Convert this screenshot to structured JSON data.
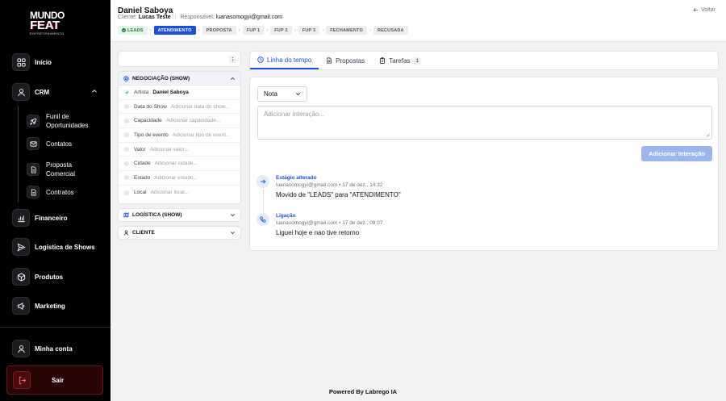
{
  "brand": {
    "line1": "MUNDO",
    "line2": "FEAT",
    "line3": "ENTRETENIMENTO"
  },
  "sidebar": {
    "items": [
      {
        "label": "Início",
        "icon": "grid-icon"
      },
      {
        "label": "CRM",
        "icon": "user-icon"
      },
      {
        "label": "Financeiro",
        "icon": "bar-chart-icon"
      },
      {
        "label": "Logística de Shows",
        "icon": "send-icon"
      },
      {
        "label": "Produtos",
        "icon": "box-icon"
      },
      {
        "label": "Marketing",
        "icon": "megaphone-icon"
      }
    ],
    "crm_sub": [
      {
        "label": "Funil de Oportunidades",
        "icon": "rocket-icon"
      },
      {
        "label": "Contatos",
        "icon": "mail-icon"
      },
      {
        "label": "Proposta Comercial",
        "icon": "document-icon"
      },
      {
        "label": "Contratos",
        "icon": "document-icon"
      }
    ],
    "account": "Minha conta",
    "logout": "Sair"
  },
  "header": {
    "title": "Daniel Saboya",
    "client_label": "Cliente:",
    "client": "Lucas Teste",
    "responsible_label": "Responsável:",
    "responsible": "luanasomogyi@gmail.com",
    "back": "Voltar",
    "stages": [
      "LEADS",
      "ATENDIMENTO",
      "PROPOSTA",
      "FUP 1",
      "FUP 2",
      "FUP 3",
      "FECHAMENTO",
      "RECUSADA"
    ],
    "completed_stage": "LEADS",
    "active_stage": "ATENDIMENTO"
  },
  "left_panel": {
    "section_title": "NEGOCIAÇÃO (SHOW)",
    "fields": [
      {
        "label": "Artista",
        "value": "Daniel Saboya",
        "filled": true
      },
      {
        "label": "Data do Show",
        "value": "Adicionar data do show...",
        "filled": false
      },
      {
        "label": "Capacidade",
        "value": "Adicionar capacidade...",
        "filled": false
      },
      {
        "label": "Tipo de evento",
        "value": "Adicionar tipo de event...",
        "filled": false
      },
      {
        "label": "Valor",
        "value": "Adicionar valor...",
        "filled": false
      },
      {
        "label": "Cidade",
        "value": "Adicionar cidade...",
        "filled": false
      },
      {
        "label": "Estado",
        "value": "Adicionar estado...",
        "filled": false
      },
      {
        "label": "Local",
        "value": "Adicionar local...",
        "filled": false
      }
    ],
    "logistics_title": "LOGÍSTICA (SHOW)",
    "client_title": "CLIENTE"
  },
  "tabs": [
    {
      "label": "Linha do tempo",
      "active": true
    },
    {
      "label": "Propostas",
      "active": false
    },
    {
      "label": "Tarefas",
      "active": false,
      "count": "1"
    }
  ],
  "timeline": {
    "note_type": "Nota",
    "placeholder": "Adicionar interação...",
    "add_button": "Adicionar Interação",
    "events": [
      {
        "type": "Estágio alterado",
        "user": "luanasomogyi@gmail.com",
        "date": "17 de dez., 14:32",
        "description": "Movido de \"LEADS\" para \"ATENDIMENTO\"",
        "icon": "arrow-right-icon"
      },
      {
        "type": "Ligação",
        "user": "luanasomogyi@gmail.com",
        "date": "17 de dez., 09:07",
        "description": "Liguei hoje e nao tive retorno",
        "icon": "phone-icon"
      }
    ]
  },
  "footer": "Powered By Labrego IA",
  "colors": {
    "accent": "#1d4ed8",
    "sidebar_bg": "#000000",
    "success": "#22783e",
    "danger": "#7a1b1b"
  }
}
